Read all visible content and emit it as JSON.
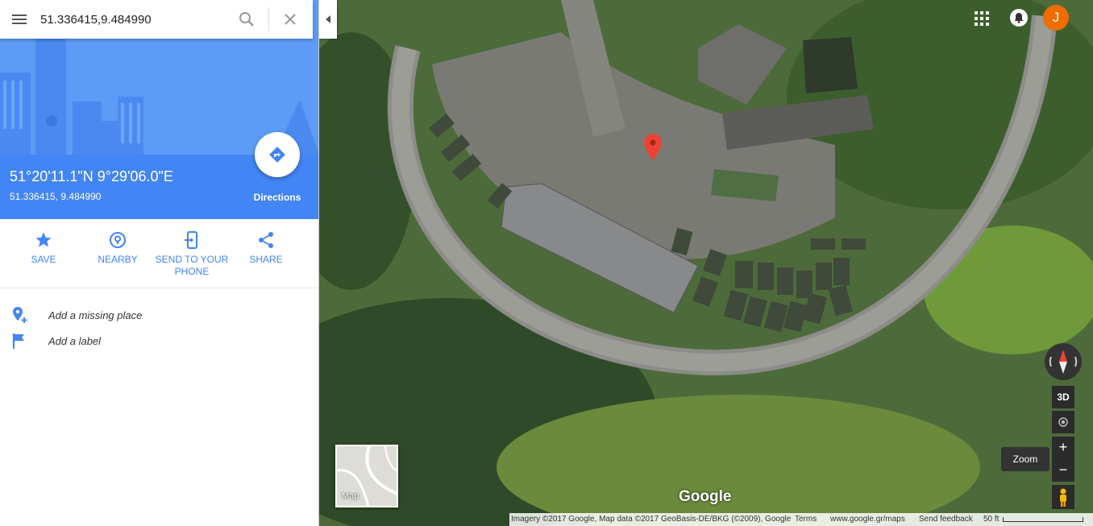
{
  "search": {
    "value": "51.336415,9.484990",
    "menu_icon": "hamburger-menu-icon",
    "search_icon": "magnifier-icon",
    "clear_icon": "close-x-icon"
  },
  "place": {
    "coords_dms": "51°20'11.1\"N 9°29'06.0\"E",
    "coords_decimal": "51.336415, 9.484990",
    "directions_label": "Directions"
  },
  "actions": [
    {
      "label": "SAVE",
      "icon": "star-icon"
    },
    {
      "label": "NEARBY",
      "icon": "nearby-pin-icon"
    },
    {
      "label": "SEND TO YOUR PHONE",
      "icon": "send-to-phone-icon"
    },
    {
      "label": "SHARE",
      "icon": "share-icon"
    }
  ],
  "extras": [
    {
      "label": "Add a missing place",
      "icon": "add-place-icon"
    },
    {
      "label": "Add a label",
      "icon": "flag-icon"
    }
  ],
  "map": {
    "account_initial": "J",
    "view_3d": "3D",
    "zoom_in": "+",
    "zoom_out": "−",
    "zoom_tooltip": "Zoom",
    "minimap_label": "Map",
    "logo": "Google",
    "footer": {
      "imagery": "Imagery ©2017 Google, Map data ©2017 GeoBasis-DE/BKG (©2009), Google",
      "terms": "Terms",
      "url": "www.google.gr/maps",
      "feedback": "Send feedback",
      "scale": "50 ft"
    }
  },
  "colors": {
    "brand_blue": "#4285f4",
    "pin_red": "#ea4335",
    "avatar_orange": "#ef6c00"
  }
}
